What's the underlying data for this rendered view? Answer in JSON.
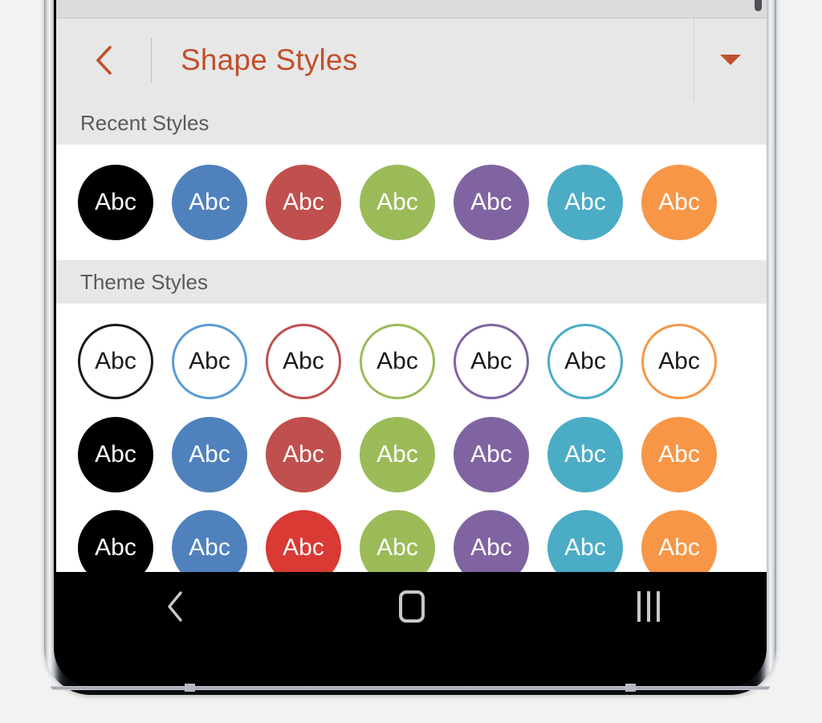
{
  "app": {
    "panel_title": "Shape Styles",
    "accent_color": "#C0502A",
    "header_bg": "#E7E7E7",
    "section_bg": "#E7E7E7",
    "gallery_bg": "#FFFFFF"
  },
  "header": {
    "back_icon": "chevron-left-icon",
    "dropdown_icon": "caret-down-icon"
  },
  "sections": [
    {
      "label": "Recent Styles",
      "rows": [
        {
          "variant": "filled",
          "chips": [
            {
              "label": "Abc",
              "color": "#000000",
              "text_color": "#FFFFFF"
            },
            {
              "label": "Abc",
              "color": "#4F81BD",
              "text_color": "#FFFFFF"
            },
            {
              "label": "Abc",
              "color": "#C0504D",
              "text_color": "#FFFFFF"
            },
            {
              "label": "Abc",
              "color": "#9BBB59",
              "text_color": "#FFFFFF"
            },
            {
              "label": "Abc",
              "color": "#8064A2",
              "text_color": "#FFFFFF"
            },
            {
              "label": "Abc",
              "color": "#4BACC6",
              "text_color": "#FFFFFF"
            },
            {
              "label": "Abc",
              "color": "#F79646",
              "text_color": "#FFFFFF"
            }
          ]
        }
      ]
    },
    {
      "label": "Theme Styles",
      "rows": [
        {
          "variant": "outline",
          "chips": [
            {
              "label": "Abc",
              "color": "#1A1A1A",
              "text_color": "#1A1A1A"
            },
            {
              "label": "Abc",
              "color": "#5B9BD5",
              "text_color": "#1A1A1A"
            },
            {
              "label": "Abc",
              "color": "#C0504D",
              "text_color": "#1A1A1A"
            },
            {
              "label": "Abc",
              "color": "#9BBB59",
              "text_color": "#1A1A1A"
            },
            {
              "label": "Abc",
              "color": "#8064A2",
              "text_color": "#1A1A1A"
            },
            {
              "label": "Abc",
              "color": "#4BACC6",
              "text_color": "#1A1A1A"
            },
            {
              "label": "Abc",
              "color": "#F79646",
              "text_color": "#1A1A1A"
            }
          ]
        },
        {
          "variant": "filled",
          "chips": [
            {
              "label": "Abc",
              "color": "#000000",
              "text_color": "#FFFFFF"
            },
            {
              "label": "Abc",
              "color": "#4F81BD",
              "text_color": "#FFFFFF"
            },
            {
              "label": "Abc",
              "color": "#C0504D",
              "text_color": "#FFFFFF"
            },
            {
              "label": "Abc",
              "color": "#9BBB59",
              "text_color": "#FFFFFF"
            },
            {
              "label": "Abc",
              "color": "#8064A2",
              "text_color": "#FFFFFF"
            },
            {
              "label": "Abc",
              "color": "#4BACC6",
              "text_color": "#FFFFFF"
            },
            {
              "label": "Abc",
              "color": "#F79646",
              "text_color": "#FFFFFF"
            }
          ]
        },
        {
          "variant": "filled",
          "chips": [
            {
              "label": "Abc",
              "color": "#000000",
              "text_color": "#FFFFFF"
            },
            {
              "label": "Abc",
              "color": "#4F81BD",
              "text_color": "#FFFFFF"
            },
            {
              "label": "Abc",
              "color": "#D93A33",
              "text_color": "#FFFFFF"
            },
            {
              "label": "Abc",
              "color": "#9BBB59",
              "text_color": "#FFFFFF"
            },
            {
              "label": "Abc",
              "color": "#8064A2",
              "text_color": "#FFFFFF"
            },
            {
              "label": "Abc",
              "color": "#4BACC6",
              "text_color": "#FFFFFF"
            },
            {
              "label": "Abc",
              "color": "#F79646",
              "text_color": "#FFFFFF"
            }
          ]
        }
      ]
    }
  ],
  "nav_bar": {
    "back_label": "back-icon",
    "home_label": "home-icon",
    "recents_label": "recents-icon",
    "bg": "#000000",
    "icon_color": "#C9C9C9"
  }
}
